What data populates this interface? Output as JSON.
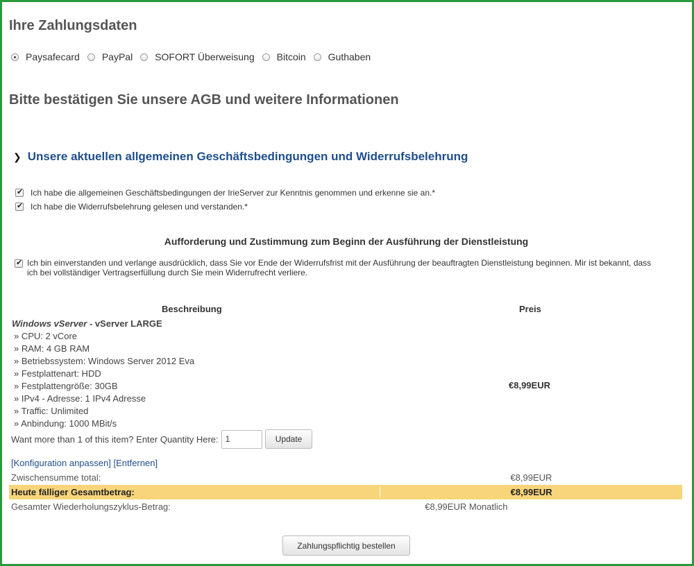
{
  "payment": {
    "title": "Ihre Zahlungsdaten",
    "methods": [
      {
        "label": "Paysafecard",
        "checked": true
      },
      {
        "label": "PayPal",
        "checked": false
      },
      {
        "label": "SOFORT Überweisung",
        "checked": false
      },
      {
        "label": "Bitcoin",
        "checked": false
      },
      {
        "label": "Guthaben",
        "checked": false
      }
    ]
  },
  "agb": {
    "title": "Bitte bestätigen Sie unsere AGB und weitere Informationen",
    "link": "Unsere aktuellen allgemeinen Geschäftsbedingungen und Widerrufsbelehrung",
    "checks": [
      "Ich habe die allgemeinen Geschäftsbedingungen der IrieServer zur Kenntnis genommen und erkenne sie an.*",
      "Ich habe die Widerrufsbelehrung gelesen und verstanden.*"
    ],
    "service_title": "Aufforderung und Zustimmung zum Beginn der Ausführung der Dienstleistung",
    "consent": "Ich bin einverstanden und verlange ausdrücklich, dass Sie vor Ende der Widerrufsfrist mit der Ausführung der beauftragten Dienstleistung beginnen. Mir ist bekannt, dass ich bei vollständiger Vertragserfüllung durch Sie mein Widerrufrecht verliere."
  },
  "order": {
    "col_desc": "Beschreibung",
    "col_price": "Preis",
    "product_group": "Windows vServer",
    "product_name": " - vServer LARGE",
    "specs": [
      "» CPU: 2 vCore",
      "» RAM: 4 GB RAM",
      "» Betriebssystem: Windows Server 2012 Eva",
      "» Festplattenart: HDD",
      "» Festplattengröße: 30GB",
      "» IPv4 - Adresse: 1 IPv4 Adresse",
      "» Traffic: Unlimited",
      "» Anbindung: 1000 MBit/s"
    ],
    "price": "€8,99EUR",
    "qty_label": "Want more than 1 of this item? Enter Quantity Here:",
    "qty_value": "1",
    "update_label": "Update",
    "config_link": "[Konfiguration anpassen]",
    "remove_link": "[Entfernen]",
    "subtotal_label": "Zwischensumme total:",
    "subtotal_value": "€8,99EUR",
    "due_label": "Heute fälliger Gesamtbetrag:",
    "due_value": "€8,99EUR",
    "recurring_label": "Gesamter Wiederholungszyklus-Betrag:",
    "recurring_value": "€8,99EUR Monatlich",
    "submit_label": "Zahlungspflichtig bestellen"
  }
}
